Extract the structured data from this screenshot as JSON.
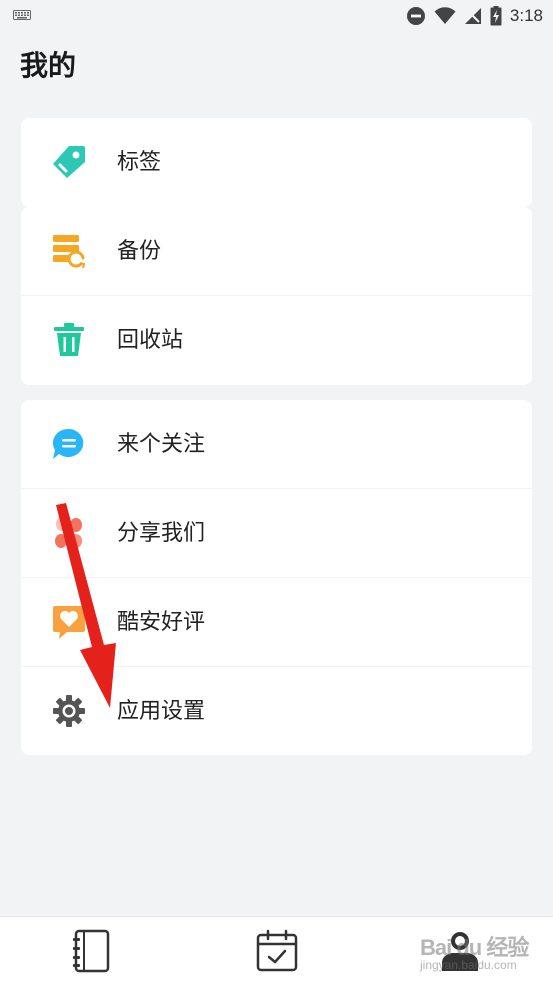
{
  "status_bar": {
    "time": "3:18"
  },
  "header": {
    "title": "我的"
  },
  "card1": {
    "items": [
      {
        "label": "标签",
        "icon": "tag-icon"
      }
    ]
  },
  "card2": {
    "items": [
      {
        "label": "备份",
        "icon": "backup-icon"
      },
      {
        "label": "回收站",
        "icon": "trash-icon"
      }
    ]
  },
  "card3": {
    "items": [
      {
        "label": "来个关注",
        "icon": "chat-bubble-icon"
      },
      {
        "label": "分享我们",
        "icon": "share-petals-icon"
      },
      {
        "label": "酷安好评",
        "icon": "heart-message-icon"
      },
      {
        "label": "应用设置",
        "icon": "gear-icon"
      }
    ]
  },
  "bottom_nav": {
    "items": [
      {
        "icon": "notebook-icon"
      },
      {
        "icon": "calendar-check-icon"
      },
      {
        "icon": "profile-icon"
      }
    ]
  },
  "watermark": {
    "main": "Bai du 经验",
    "sub": "jingyan.baidu.com"
  },
  "colors": {
    "tag": "#2bc9b4",
    "backup": "#f5a623",
    "trash": "#1ec99a",
    "chat": "#29b6f6",
    "petals": "#f4735e",
    "heart_msg": "#f9a03f",
    "gear": "#555555",
    "arrow": "#e5211b"
  }
}
